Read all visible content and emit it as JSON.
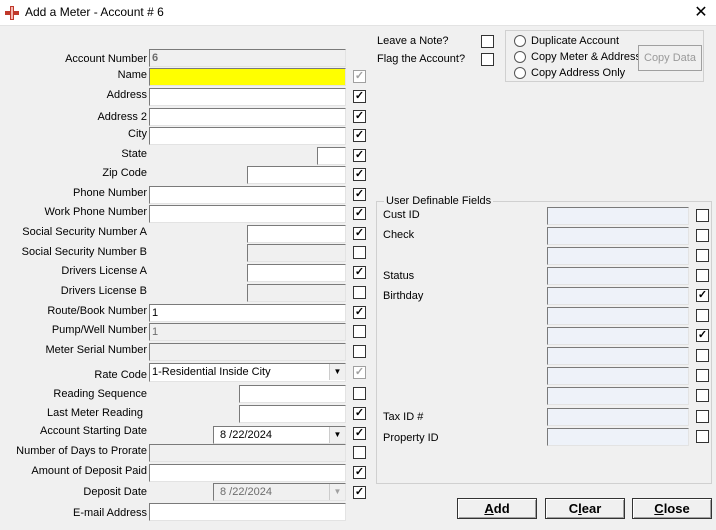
{
  "window": {
    "title": "Add a Meter - Account # 6"
  },
  "fields": [
    {
      "key": "account_number",
      "label": "Account Number",
      "value": "6"
    },
    {
      "key": "name",
      "label": "Name",
      "value": ""
    },
    {
      "key": "address",
      "label": "Address",
      "value": ""
    },
    {
      "key": "address2",
      "label": "Address 2",
      "value": ""
    },
    {
      "key": "city",
      "label": "City",
      "value": ""
    },
    {
      "key": "state",
      "label": "State",
      "value": ""
    },
    {
      "key": "zip",
      "label": "Zip Code",
      "value": ""
    },
    {
      "key": "phone",
      "label": "Phone Number",
      "value": ""
    },
    {
      "key": "work_phone",
      "label": "Work Phone Number",
      "value": ""
    },
    {
      "key": "ssn_a",
      "label": "Social Security Number A",
      "value": ""
    },
    {
      "key": "ssn_b",
      "label": "Social Security Number B",
      "value": ""
    },
    {
      "key": "dl_a",
      "label": "Drivers License A",
      "value": ""
    },
    {
      "key": "dl_b",
      "label": "Drivers License B",
      "value": ""
    },
    {
      "key": "route_book",
      "label": "Route/Book Number",
      "value": "1"
    },
    {
      "key": "pump_well",
      "label": "Pump/Well Number",
      "value": "1"
    },
    {
      "key": "meter_serial",
      "label": "Meter Serial Number",
      "value": ""
    },
    {
      "key": "rate_code",
      "label": "Rate Code",
      "value": "1-Residential Inside City"
    },
    {
      "key": "reading_seq",
      "label": "Reading Sequence",
      "value": ""
    },
    {
      "key": "last_reading",
      "label": "Last Meter Reading",
      "value": ""
    },
    {
      "key": "start_date",
      "label": "Account Starting Date",
      "value": "8 /22/2024"
    },
    {
      "key": "days_prorate",
      "label": "Number of Days to Prorate",
      "value": ""
    },
    {
      "key": "deposit_amount",
      "label": "Amount of Deposit Paid",
      "value": ""
    },
    {
      "key": "deposit_date",
      "label": "Deposit Date",
      "value": "8 /22/2024"
    },
    {
      "key": "email",
      "label": "E-mail Address",
      "value": ""
    }
  ],
  "right_options": {
    "leave_note": "Leave a Note?",
    "flag_account": "Flag the Account?",
    "radio_duplicate": "Duplicate Account",
    "radio_copy_meter": "Copy Meter & Address",
    "radio_copy_address": "Copy Address Only",
    "copy_data_button": "Copy Data"
  },
  "udf": {
    "title": "User Definable Fields",
    "rows": [
      {
        "label": "Cust ID",
        "checked": false
      },
      {
        "label": "Check",
        "checked": false
      },
      {
        "label": "",
        "checked": false
      },
      {
        "label": "Status",
        "checked": false
      },
      {
        "label": "Birthday",
        "checked": true
      },
      {
        "label": "",
        "checked": false
      },
      {
        "label": "",
        "checked": true
      },
      {
        "label": "",
        "checked": false
      },
      {
        "label": "",
        "checked": false
      },
      {
        "label": "",
        "checked": false
      },
      {
        "label": "Tax ID #",
        "checked": false
      },
      {
        "label": "Property ID",
        "checked": false
      }
    ]
  },
  "buttons": {
    "add": {
      "pre": "",
      "accel": "A",
      "post": "dd"
    },
    "clear": {
      "pre": "C",
      "accel": "l",
      "post": "ear"
    },
    "close": {
      "pre": "",
      "accel": "C",
      "post": "lose"
    }
  },
  "glyphs": {
    "check": "✓",
    "arrow": "▼",
    "close": "✕"
  }
}
